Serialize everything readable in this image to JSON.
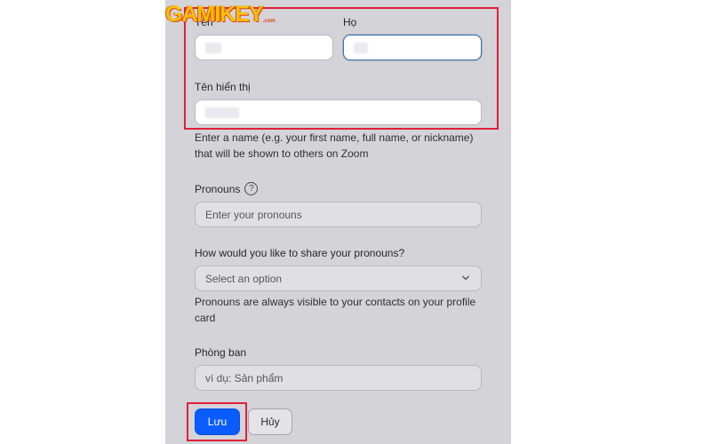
{
  "watermark": {
    "text": "GAMIKEY",
    "suffix": ".com"
  },
  "form": {
    "first_name_label": "Tên",
    "last_name_label": "Họ",
    "display_name_label": "Tên hiển thị",
    "display_name_help": "Enter a name (e.g. your first name, full name, or nickname) that will be shown to others on Zoom",
    "pronouns_label": "Pronouns",
    "pronouns_placeholder": "Enter your pronouns",
    "share_pronouns_label": "How would you like to share your pronouns?",
    "share_pronouns_value": "Select an option",
    "share_pronouns_help": "Pronouns are always visible to your contacts on your profile card",
    "department_label": "Phòng ban",
    "department_placeholder": "ví dụ: Sản phẩm"
  },
  "actions": {
    "save_label": "Lưu",
    "cancel_label": "Hủy"
  },
  "icons": {
    "help": "question-circle-icon",
    "dropdown": "chevron-down-icon"
  },
  "colors": {
    "primary": "#0b5cff",
    "highlight": "#e0203a",
    "panel": "#d3d3d8"
  }
}
